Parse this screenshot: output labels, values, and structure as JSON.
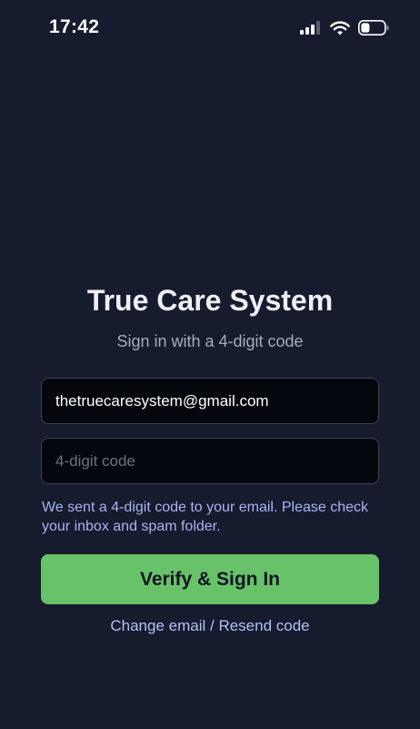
{
  "status_bar": {
    "time": "17:42",
    "icons": [
      "cellular-signal-icon",
      "wifi-icon",
      "battery-icon"
    ]
  },
  "login": {
    "title": "True Care System",
    "subtitle": "Sign in with a 4-digit code",
    "email_value": "thetruecaresystem@gmail.com",
    "code_placeholder": "4-digit code",
    "hint": "We sent a 4-digit code to your email. Please check your inbox and spam folder.",
    "verify_label": "Verify & Sign In",
    "change_link": "Change email / Resend code"
  },
  "colors": {
    "background": "#161b2e",
    "field_background": "#05070f",
    "field_border": "#3e4454",
    "primary_button": "#68c26a",
    "hint_text": "#aab4f2",
    "link_text": "#b1c2f2"
  }
}
